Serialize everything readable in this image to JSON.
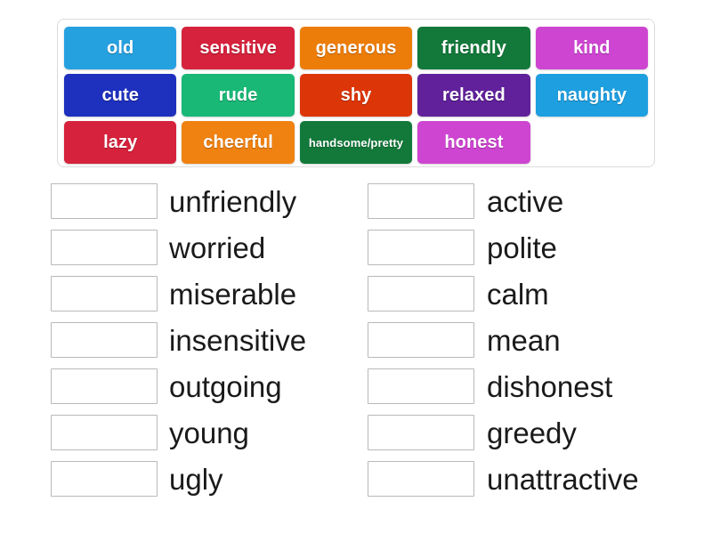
{
  "word_bank": {
    "rows": [
      [
        {
          "label": "old",
          "color": "#26a1e0",
          "size": "normal"
        },
        {
          "label": "sensitive",
          "color": "#d6223c",
          "size": "normal"
        },
        {
          "label": "generous",
          "color": "#ed7d09",
          "size": "normal"
        },
        {
          "label": "friendly",
          "color": "#12793a",
          "size": "normal"
        },
        {
          "label": "kind",
          "color": "#ce45d1",
          "size": "normal"
        }
      ],
      [
        {
          "label": "cute",
          "color": "#1e30be",
          "size": "normal"
        },
        {
          "label": "rude",
          "color": "#19b876",
          "size": "normal"
        },
        {
          "label": "shy",
          "color": "#dc3608",
          "size": "normal"
        },
        {
          "label": "relaxed",
          "color": "#61219b",
          "size": "normal"
        },
        {
          "label": "naughty",
          "color": "#1e9fe0",
          "size": "normal"
        }
      ],
      [
        {
          "label": "lazy",
          "color": "#d6223c",
          "size": "normal"
        },
        {
          "label": "cheerful",
          "color": "#ef8211",
          "size": "normal"
        },
        {
          "label": "handsome/pretty",
          "color": "#12793a",
          "size": "small"
        },
        {
          "label": "honest",
          "color": "#ce45d1",
          "size": "normal"
        },
        {
          "label": "",
          "color": "transparent",
          "size": "empty"
        }
      ]
    ]
  },
  "answers": {
    "left_column": [
      {
        "blank_value": "",
        "label": "unfriendly"
      },
      {
        "blank_value": "",
        "label": "worried"
      },
      {
        "blank_value": "",
        "label": "miserable"
      },
      {
        "blank_value": "",
        "label": "insensitive"
      },
      {
        "blank_value": "",
        "label": "outgoing"
      },
      {
        "blank_value": "",
        "label": "young"
      },
      {
        "blank_value": "",
        "label": "ugly"
      }
    ],
    "right_column": [
      {
        "blank_value": "",
        "label": "active"
      },
      {
        "blank_value": "",
        "label": "polite"
      },
      {
        "blank_value": "",
        "label": "calm"
      },
      {
        "blank_value": "",
        "label": "mean"
      },
      {
        "blank_value": "",
        "label": "dishonest"
      },
      {
        "blank_value": "",
        "label": "greedy"
      },
      {
        "blank_value": "",
        "label": "unattractive"
      }
    ]
  }
}
